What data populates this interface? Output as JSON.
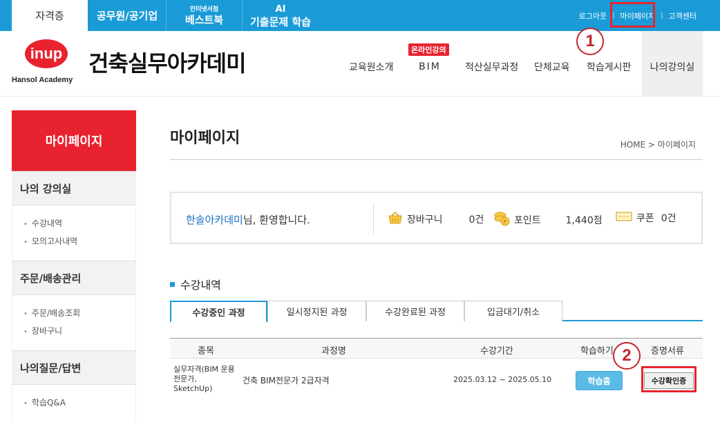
{
  "topbar": {
    "tabs": [
      {
        "big": "자격증"
      },
      {
        "big": "공무원/공기업"
      },
      {
        "small": "인터넷서점",
        "big": "베스트북"
      },
      {
        "small": "AI",
        "big": "기출문제 학습"
      }
    ],
    "links": [
      "로그아웃",
      "마이페이지",
      "고객센터"
    ]
  },
  "brand": {
    "logo": "inup",
    "logo_sub": "Hansol Academy",
    "name": "건축실무아카데미"
  },
  "nav": {
    "items": [
      "교육원소개",
      "BIM",
      "적산실무과정",
      "단체교육",
      "학습게시판",
      "나의강의실"
    ],
    "badge": "온라인강의"
  },
  "annotations": {
    "one": "1",
    "two": "2"
  },
  "sidebar": {
    "title": "마이페이지",
    "sections": [
      {
        "title": "나의 강의실",
        "items": [
          "수강내역",
          "모의고사내역"
        ]
      },
      {
        "title": "주문/배송관리",
        "items": [
          "주문/배송조회",
          "장바구니"
        ]
      },
      {
        "title": "나의질문/답변",
        "items": [
          "학습Q&A"
        ]
      }
    ]
  },
  "main": {
    "title": "마이페이지",
    "breadcrumb": "HOME > 마이페이지",
    "welcome": {
      "name": "한솔아카데미",
      "suffix": "님, 환영합니다."
    },
    "stats": {
      "cart_label": "장바구니",
      "cart_value": "0건",
      "point_label": "포인트",
      "point_value": "1,440점",
      "coupon_label": "쿠폰",
      "coupon_value": "0건"
    },
    "section_title": "수강내역",
    "tabs": [
      "수강중인 과정",
      "일시정지된 과정",
      "수강완료된 과정",
      "입금대기/취소"
    ],
    "columns": [
      "종목",
      "과정명",
      "수강기간",
      "학습하기",
      "증명서류"
    ],
    "row": {
      "category": "실무자격(BIM 운용전문가, SketchUp)",
      "course": "건축 BIM전문가 2급자격",
      "period": "2025.03.12 ~ 2025.05.10",
      "study_button": "학습홈",
      "cert_button": "수강확인증"
    }
  },
  "colors": {
    "accent": "#1a9bd7",
    "brand_red": "#e8232f",
    "annotation_red": "#c4262e"
  }
}
